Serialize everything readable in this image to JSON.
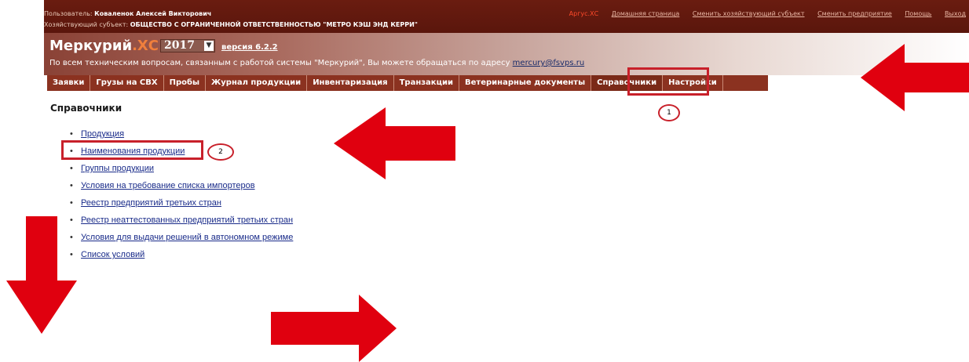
{
  "topbar": {
    "user_label": "Пользователь: ",
    "user_name": "Коваленок Алексей Викторович",
    "entity_label": "Хозяйствующий субъект: ",
    "entity_name": "ОБЩЕСТВО С ОГРАНИЧЕННОЙ ОТВЕТСТВЕННОСТЬЮ \"МЕТРО КЭШ ЭНД КЕРРИ\"",
    "links": [
      "Аргус.ХС",
      "Домашняя страница",
      "Сменить хозяйствующий субъект",
      "Сменить предприятие",
      "Помощь",
      "Выход"
    ]
  },
  "brand": {
    "name": "Меркурий",
    "suffix": ".ХС",
    "year": "2017",
    "version": "версия 6.2.2",
    "support_text": "По всем техническим вопросам, связанным с работой системы \"Меркурий\", Вы можете обращаться по адресу ",
    "support_email": "mercury@fsvps.ru"
  },
  "nav": {
    "tabs": [
      "Заявки",
      "Грузы на СВХ",
      "Пробы",
      "Журнал продукции",
      "Инвентаризация",
      "Транзакции",
      "Ветеринарные документы",
      "Справочники",
      "Настройки"
    ],
    "active": "Справочники"
  },
  "page": {
    "title": "Справочники",
    "items": [
      "Продукция",
      "Наименования продукции",
      "Группы продукции",
      "Условия на требование списка импортеров",
      "Реестр предприятий третьих стран",
      "Реестр неаттестованных предприятий третьих стран",
      "Условия для выдачи решений в автономном режиме",
      "Список условий"
    ]
  },
  "annotations": {
    "step1": "1",
    "step2": "2",
    "color": "#e0000f"
  }
}
